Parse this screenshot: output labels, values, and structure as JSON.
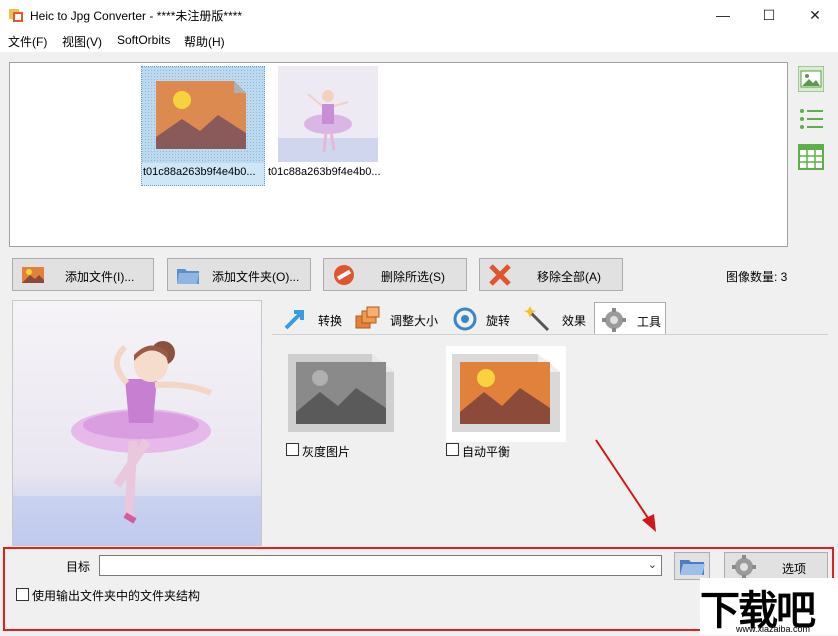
{
  "window": {
    "title": "Heic to Jpg Converter - ****未注册版****"
  },
  "menu": [
    "文件(F)",
    "视图(V)",
    "SoftOrbits",
    "帮助(H)"
  ],
  "files": [
    {
      "name": "t01c88a263b9f4e4b0..."
    },
    {
      "name": "t01c88a263b9f4e4b0..."
    }
  ],
  "toolbar": {
    "add_files": "添加文件(I)...",
    "add_folder": "添加文件夹(O)...",
    "remove_selected": "删除所选(S)",
    "remove_all": "移除全部(A)"
  },
  "image_count": "图像数量: 3",
  "tabs": [
    "转换",
    "调整大小",
    "旋转",
    "效果",
    "工具"
  ],
  "active_tab": "工具",
  "effects": [
    {
      "label": "灰度图片",
      "checked": false
    },
    {
      "label": "自动平衡",
      "checked": false
    }
  ],
  "target": {
    "label": "目标",
    "value": ""
  },
  "options_label": "选项",
  "use_folder_structure": {
    "label": "使用输出文件夹中的文件夹结构",
    "checked": false
  },
  "watermark": {
    "brand": "下载吧",
    "url": "www.xiazaiba.com"
  },
  "colors": {
    "highlight_border": "#e02020",
    "arrow": "#d01818"
  }
}
